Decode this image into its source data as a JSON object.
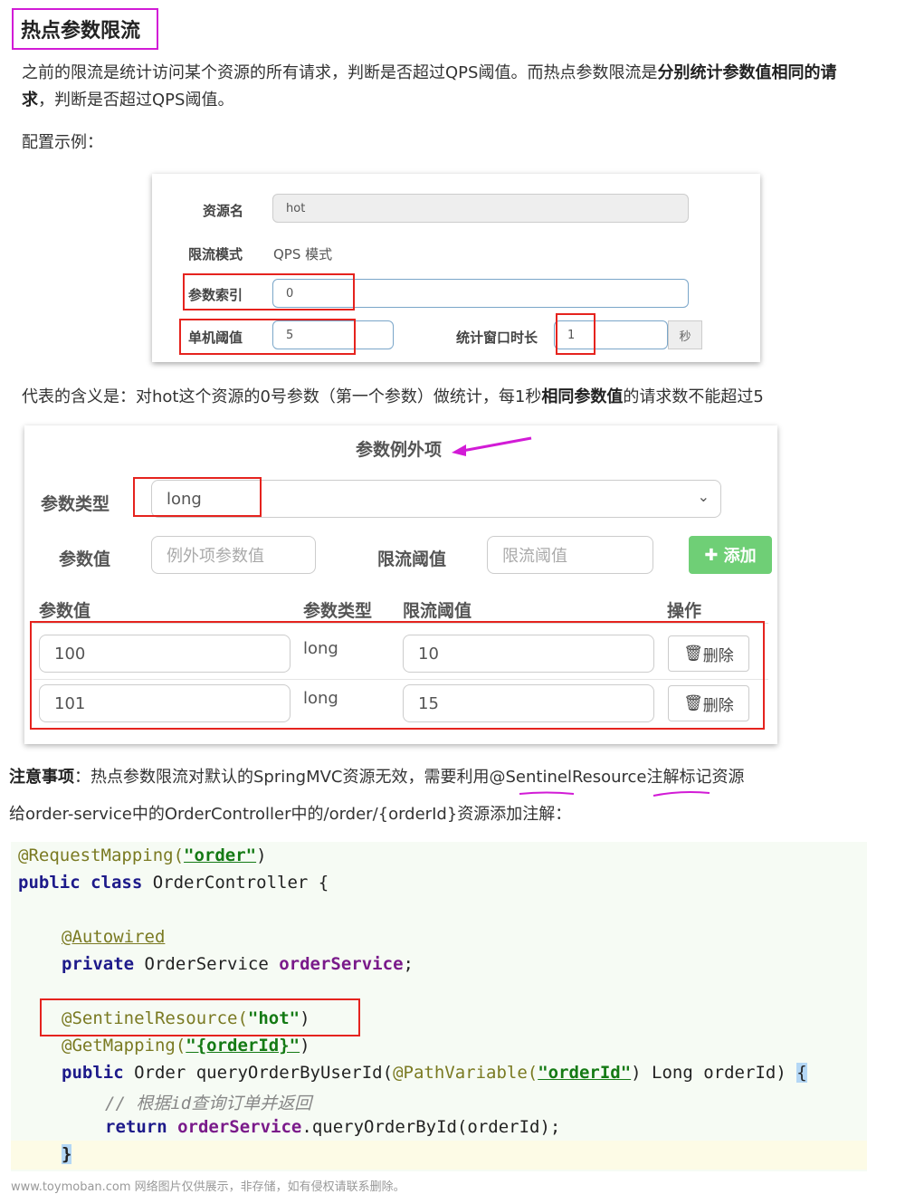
{
  "title": "热点参数限流",
  "intro": {
    "part1": "之前的限流是统计访问某个资源的所有请求，判断是否超过QPS阈值。而热点参数限流是",
    "bold1": "分别统计参数值相同的请",
    "bold2": "求",
    "part2": "，判断是否超过QPS阈值。"
  },
  "config_example": "配置示例：",
  "shot1": {
    "resource_label": "资源名",
    "resource_value": "hot",
    "mode_label": "限流模式",
    "mode_value": "QPS 模式",
    "index_label": "参数索引",
    "index_value": "0",
    "threshold_label": "单机阈值",
    "threshold_value": "5",
    "window_label": "统计窗口时长",
    "window_value": "1",
    "window_unit": "秒"
  },
  "meaning": {
    "part1": "代表的含义是：对hot这个资源的0号参数（第一个参数）做统计，每1秒",
    "bold": "相同参数值",
    "part2": "的请求数不能超过5"
  },
  "shot2": {
    "heading": "参数例外项",
    "type_label": "参数类型",
    "type_value": "long",
    "value_label": "参数值",
    "value_placeholder": "例外项参数值",
    "limit_label": "限流阈值",
    "limit_placeholder": "限流阈值",
    "add_button": "添加",
    "table_headers": [
      "参数值",
      "参数类型",
      "限流阈值",
      "操作"
    ],
    "rows": [
      {
        "value": "100",
        "type": "long",
        "limit": "10",
        "action": "删除"
      },
      {
        "value": "101",
        "type": "long",
        "limit": "15",
        "action": "删除"
      }
    ]
  },
  "note": {
    "bold": "注意事项",
    "text": "：热点参数限流对默认的SpringMVC资源无效，需要利用@SentinelResource注解标记资源"
  },
  "instruction": "给order-service中的OrderController中的/order/{orderId}资源添加注解：",
  "code": {
    "l1_ann": "@RequestMapping(",
    "l1_str": "\"order\"",
    "l1_end": ")",
    "l2_kw1": "public",
    "l2_kw2": "class",
    "l2_rest": " OrderController {",
    "l3_ann": "@Autowired",
    "l4_kw": "private",
    "l4_type": " OrderService ",
    "l4_fld": "orderService",
    "l4_end": ";",
    "l5_ann": "@SentinelResource(",
    "l5_str": "\"hot\"",
    "l5_end": ")",
    "l6_ann": "@GetMapping(",
    "l6_str": "\"{orderId}\"",
    "l6_end": ")",
    "l7_kw": "public",
    "l7_rest": " Order queryOrderByUserId(",
    "l7_ann": "@PathVariable(",
    "l7_str": "\"orderId\"",
    "l7_end": ") Long orderId) ",
    "l7_brace": "{",
    "l8_cmt": "// 根据id查询订单并返回",
    "l9_kw": "return",
    "l9_fld": "orderService",
    "l9_rest": ".queryOrderById(orderId);",
    "l10": "}"
  },
  "watermark": "www.toymoban.com 网络图片仅供展示，非存储，如有侵权请联系删除。"
}
